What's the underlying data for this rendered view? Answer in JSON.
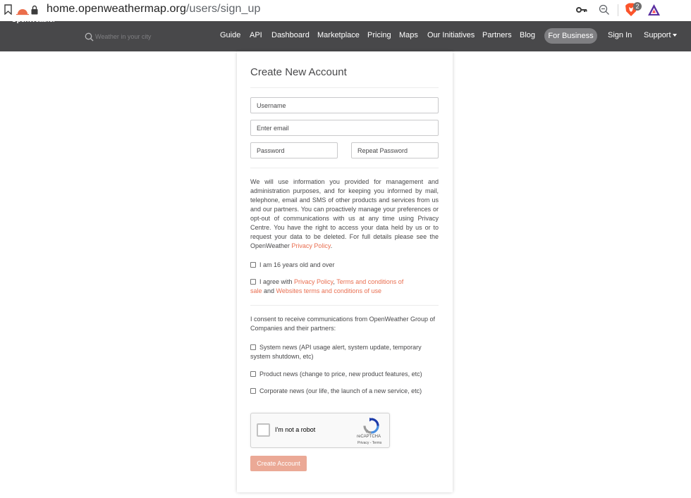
{
  "browser": {
    "url_host": "home.openweathermap.org",
    "url_path": "/users/sign_up",
    "brave_badge_count": "2"
  },
  "nav": {
    "logo_text": "OpenWeather",
    "search_placeholder": "Weather in your city",
    "links": [
      "Guide",
      "API",
      "Dashboard",
      "Marketplace",
      "Pricing",
      "Maps",
      "Our Initiatives",
      "Partners",
      "Blog"
    ],
    "business_button": "For Business",
    "sign_in": "Sign In",
    "support": "Support"
  },
  "form": {
    "title": "Create New Account",
    "username_placeholder": "Username",
    "email_placeholder": "Enter email",
    "password_placeholder": "Password",
    "repeat_password_placeholder": "Repeat Password",
    "policy_text": "We will use information you provided for management and administration purposes, and for keeping you informed by mail, telephone, email and SMS of other products and services from us and our partners. You can proactively manage your preferences or opt-out of communications with us at any time using Privacy Centre. You have the right to access your data held by us or to request your data to be deleted. For full details please see the OpenWeather ",
    "policy_link": "Privacy Policy",
    "policy_end": ".",
    "age_label": "I am 16 years old and over",
    "agree_prefix": "I agree with ",
    "agree_link1": "Privacy Policy",
    "agree_sep": ", ",
    "agree_link2": "Terms and conditions of sale",
    "agree_and": " and ",
    "agree_link3": "Websites terms and conditions of use",
    "consent_text": "I consent to receive communications from OpenWeather Group of Companies and their partners:",
    "system_news": "System news (API usage alert, system update, temporary system shutdown, etc)",
    "product_news": "Product news (change to price, new product features, etc)",
    "corporate_news": "Corporate news (our life, the launch of a new service, etc)",
    "captcha_label": "I'm not a robot",
    "captcha_brand": "reCAPTCHA",
    "captcha_links": "Privacy - Terms",
    "submit": "Create Account"
  },
  "colors": {
    "navbar": "#48484a",
    "accent_link": "#e96e50",
    "button": "#eba996",
    "pill": "#7f7f82"
  }
}
